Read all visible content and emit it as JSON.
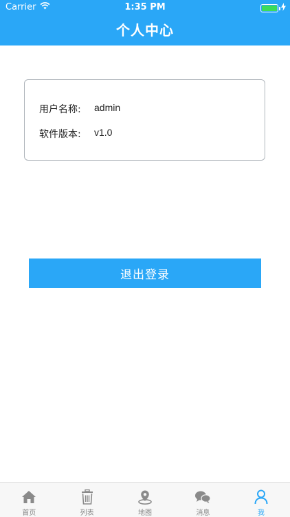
{
  "status_bar": {
    "carrier": "Carrier",
    "time": "1:35 PM"
  },
  "header": {
    "title": "个人中心"
  },
  "profile": {
    "username_label": "用户名称:",
    "username_value": "admin",
    "version_label": "软件版本:",
    "version_value": "v1.0"
  },
  "actions": {
    "logout_label": "退出登录"
  },
  "tab_bar": {
    "items": [
      {
        "label": "首页",
        "icon": "home-icon",
        "active": false
      },
      {
        "label": "列表",
        "icon": "trash-icon",
        "active": false
      },
      {
        "label": "地图",
        "icon": "map-pin-icon",
        "active": false
      },
      {
        "label": "消息",
        "icon": "chat-icon",
        "active": false
      },
      {
        "label": "我",
        "icon": "user-icon",
        "active": true
      }
    ]
  },
  "colors": {
    "accent": "#2aa7f7",
    "tab_inactive": "#888888",
    "battery": "#3bdc5a"
  }
}
